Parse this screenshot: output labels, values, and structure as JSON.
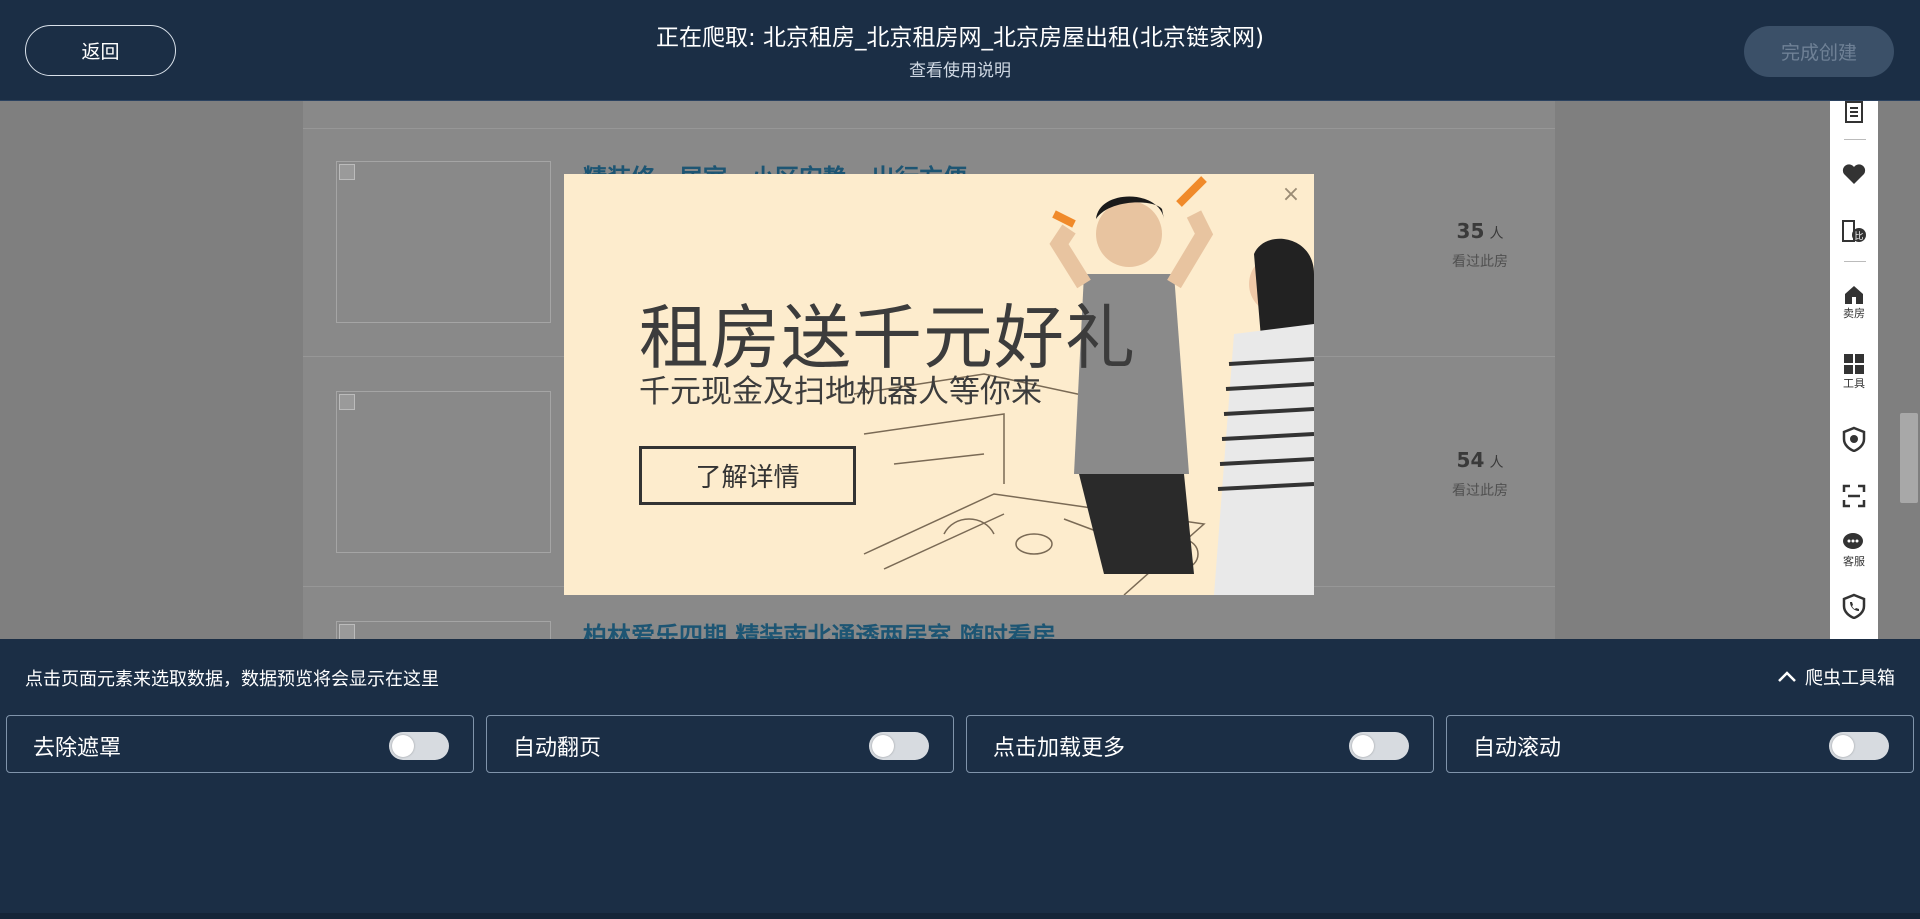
{
  "header": {
    "back_label": "返回",
    "title": "正在爬取: 北京租房_北京租房网_北京房屋出租(北京链家网)",
    "subtitle": "查看使用说明",
    "done_label": "完成创建"
  },
  "listings": [
    {
      "title": "精装修一居室，小区安静，出行方便",
      "views_count": "35",
      "views_unit": "人",
      "views_label": "看过此房"
    },
    {
      "title": "",
      "views_count": "54",
      "views_unit": "人",
      "views_label": "看过此房"
    },
    {
      "title": "柏林爱乐四期 精装南北通透两居室 随时看房",
      "views_count": "",
      "views_unit": "",
      "views_label": ""
    }
  ],
  "rail": {
    "items": [
      {
        "icon": "list-icon",
        "label": ""
      },
      {
        "icon": "heart-icon",
        "label": ""
      },
      {
        "icon": "compare-icon",
        "label": ""
      },
      {
        "icon": "sell-house-icon",
        "label": "卖房"
      },
      {
        "icon": "tools-icon",
        "label": "工具"
      },
      {
        "icon": "shield-icon",
        "label": ""
      },
      {
        "icon": "scan-icon",
        "label": ""
      },
      {
        "icon": "chat-icon",
        "label": "客服"
      },
      {
        "icon": "phone-icon",
        "label": ""
      }
    ]
  },
  "modal": {
    "headline": "租房送千元好礼",
    "subline": "千元现金及扫地机器人等你来",
    "button_label": "了解详情",
    "close_icon": "close-icon"
  },
  "panel": {
    "hint": "点击页面元素来选取数据，数据预览将会显示在这里",
    "toolbox_label": "爬虫工具箱",
    "toggles": [
      {
        "label": "去除遮罩",
        "on": false
      },
      {
        "label": "自动翻页",
        "on": false
      },
      {
        "label": "点击加载更多",
        "on": false
      },
      {
        "label": "自动滚动",
        "on": false
      }
    ]
  }
}
